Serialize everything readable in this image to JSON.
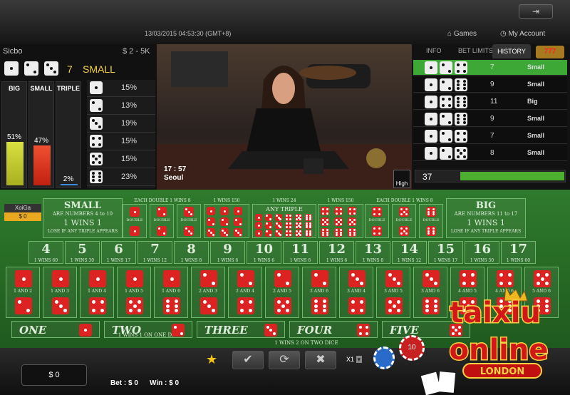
{
  "header": {
    "datetime": "13/03/2015 04:53:30 (GMT+8)",
    "nav": {
      "games": "Games",
      "account": "My Account"
    }
  },
  "game": {
    "name": "Sicbo",
    "limits": "$ 2 - 5K",
    "last_result": {
      "dice": [
        1,
        2,
        3
      ],
      "total": "7",
      "label": "SMALL"
    }
  },
  "stats": {
    "big": {
      "label": "BIG",
      "pct": "51%",
      "value": 51
    },
    "small": {
      "label": "SMALL",
      "pct": "47%",
      "value": 47
    },
    "triple": {
      "label": "TRIPLE",
      "pct": "2%",
      "value": 2
    },
    "singles": [
      {
        "die": 1,
        "pct": "15%"
      },
      {
        "die": 2,
        "pct": "13%"
      },
      {
        "die": 3,
        "pct": "19%"
      },
      {
        "die": 4,
        "pct": "15%"
      },
      {
        "die": 5,
        "pct": "15%"
      },
      {
        "die": 6,
        "pct": "23%"
      }
    ]
  },
  "video": {
    "time": "17 : 57",
    "city": "Seoul",
    "quality": "High"
  },
  "right_tabs": {
    "info": "INFO",
    "bet_limits": "BET LIMITS",
    "history": "HISTORY"
  },
  "history": [
    {
      "dice": [
        1,
        2,
        4
      ],
      "sum": "7",
      "result": "Small"
    },
    {
      "dice": [
        1,
        2,
        6
      ],
      "sum": "9",
      "result": "Small"
    },
    {
      "dice": [
        1,
        4,
        6
      ],
      "sum": "11",
      "result": "Big"
    },
    {
      "dice": [
        1,
        2,
        6
      ],
      "sum": "9",
      "result": "Small"
    },
    {
      "dice": [
        1,
        2,
        4
      ],
      "sum": "7",
      "result": "Small"
    },
    {
      "dice": [
        1,
        2,
        5
      ],
      "sum": "8",
      "result": "Small"
    }
  ],
  "round": {
    "number": "37"
  },
  "table": {
    "small": {
      "title": "SMALL",
      "sub": "ARE NUMBERS 4 to 10",
      "odds": "1 WINS 1",
      "note": "LOSE IF ANY TRIPLE APPEARS"
    },
    "big": {
      "title": "BIG",
      "sub": "ARE NUMBERS 11 to 17",
      "odds": "1 WINS 1",
      "note": "LOSE IF ANY TRIPLE APPEARS"
    },
    "double_hdr_left": "EACH DOUBLE 1 WINS 8",
    "double_hdr_right": "EACH DOUBLE 1 WINS 8",
    "triple_hdr_left": "1 WINS 150",
    "any_triple_odds": "1 WINS 24",
    "any_triple": "ANY TRIPLE",
    "triple_hdr_right": "1 WINS 150",
    "double_label": "DOUBLE",
    "totals": [
      {
        "n": "4",
        "o": "1 WINS 60"
      },
      {
        "n": "5",
        "o": "1 WINS 30"
      },
      {
        "n": "6",
        "o": "1 WINS 17"
      },
      {
        "n": "7",
        "o": "1 WINS 12"
      },
      {
        "n": "8",
        "o": "1 WINS 8"
      },
      {
        "n": "9",
        "o": "1 WINS 6"
      },
      {
        "n": "10",
        "o": "1 WINS 6"
      },
      {
        "n": "11",
        "o": "1 WINS 6"
      },
      {
        "n": "12",
        "o": "1 WINS 6"
      },
      {
        "n": "13",
        "o": "1 WINS 8"
      },
      {
        "n": "14",
        "o": "1 WINS 12"
      },
      {
        "n": "15",
        "o": "1 WINS 17"
      },
      {
        "n": "16",
        "o": "1 WINS 30"
      },
      {
        "n": "17",
        "o": "1 WINS 60"
      }
    ],
    "combos": [
      "1 AND 2",
      "1 AND 3",
      "1 AND 4",
      "1 AND 5",
      "1 AND 6",
      "2 AND 3",
      "2 AND 4",
      "2 AND 5",
      "2 AND 6",
      "3 AND 4",
      "3 AND 5",
      "3 AND 6",
      "4 AND 5",
      "4 AND 6",
      "5 AND 6"
    ],
    "singles": [
      "ONE",
      "TWO",
      "THREE",
      "FOUR",
      "FIVE"
    ],
    "single_odds": "1 WINS 1 ON ONE DICE",
    "single_odds2": "1 WINS 2 ON TWO DICE"
  },
  "player": {
    "name": "XoiGa",
    "amount": "$ 0"
  },
  "bottom": {
    "balance": "$ 0",
    "bet": "Bet : $ 0",
    "win": "Win : $ 0",
    "multiplier": "X1"
  },
  "watermark": {
    "l1": "taixiu",
    "l2": "online",
    "l3": "LONDON"
  }
}
